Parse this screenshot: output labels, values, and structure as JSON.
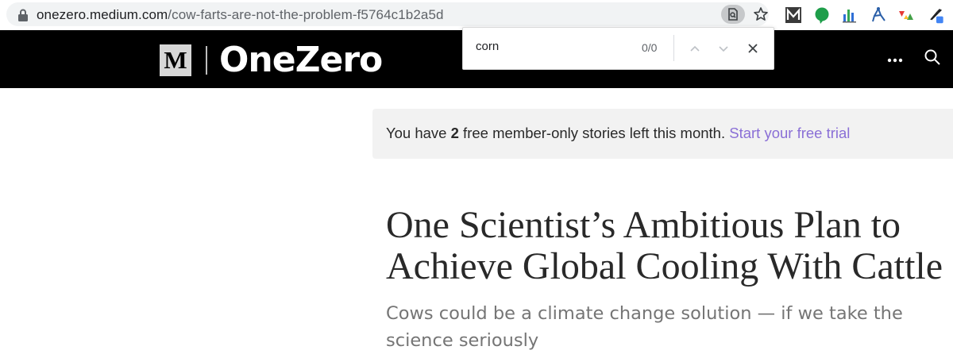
{
  "browser": {
    "url_domain": "onezero.medium.com",
    "url_path": "/cow-farts-are-not-the-problem-f5764c1b2a5d",
    "icons": [
      "lock-icon",
      "find-in-page-icon",
      "bookmark-star-icon"
    ],
    "extensions": [
      "medium-extension-icon",
      "green-chat-extension-icon",
      "bar-chart-extension-icon",
      "network-extension-icon",
      "triangles-extension-icon",
      "eyedropper-extension-icon"
    ]
  },
  "find_bar": {
    "query": "corn",
    "match_count": "0/0",
    "icons": [
      "previous-match-icon",
      "next-match-icon",
      "close-icon"
    ]
  },
  "header": {
    "logo_letter": "M",
    "publication": "OneZero",
    "icons": [
      "more-options-icon",
      "search-icon"
    ]
  },
  "member_banner": {
    "text_before": "You have ",
    "count": "2",
    "text_after": " free member-only stories left this month. ",
    "link_label": "Start your free trial",
    "link_color": "#8a6fd6"
  },
  "article": {
    "title_line1": "One Scientist’s Ambitious Plan to",
    "title_line2": "Achieve Global Cooling With Cattle",
    "subtitle": "Cows could be a climate change solution — if we take the science seriously"
  }
}
